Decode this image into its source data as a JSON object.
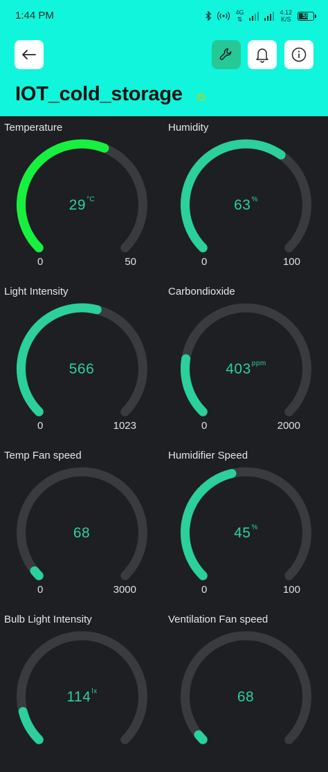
{
  "status_bar": {
    "time": "1:44 PM",
    "network": "4G",
    "speed_value": "4.12",
    "speed_unit": "K/S",
    "battery": "59"
  },
  "header": {
    "title": "IOT_cold_storage",
    "online_color": "#b7d21a",
    "accent_color": "#10f5db"
  },
  "widgets": [
    {
      "label": "Temperature",
      "value": "29",
      "unit": "°C",
      "min": "0",
      "max": "50",
      "level": 0.58,
      "color": "#18f040"
    },
    {
      "label": "Humidity",
      "value": "63",
      "unit": "%",
      "min": "0",
      "max": "100",
      "level": 0.63,
      "color": "#2bd09a"
    },
    {
      "label": "Light Intensity",
      "value": "566",
      "unit": "",
      "min": "0",
      "max": "1023",
      "level": 0.553,
      "color": "#2bd09a"
    },
    {
      "label": "Carbondioxide",
      "value": "403",
      "unit": "ppm",
      "min": "0",
      "max": "2000",
      "level": 0.2015,
      "color": "#2bd09a"
    },
    {
      "label": "Temp Fan speed",
      "value": "68",
      "unit": "",
      "min": "0",
      "max": "3000",
      "level": 0.0227,
      "color": "#2bd09a"
    },
    {
      "label": "Humidifier Speed",
      "value": "45",
      "unit": "%",
      "min": "0",
      "max": "100",
      "level": 0.45,
      "color": "#2bd09a"
    },
    {
      "label": "Bulb Light Intensity",
      "value": "114",
      "unit": "lx",
      "min": "",
      "max": "",
      "level": 0.114,
      "color": "#2bd09a"
    },
    {
      "label": "Ventilation Fan speed",
      "value": "68",
      "unit": "",
      "min": "",
      "max": "",
      "level": 0.0227,
      "color": "#2bd09a"
    }
  ]
}
